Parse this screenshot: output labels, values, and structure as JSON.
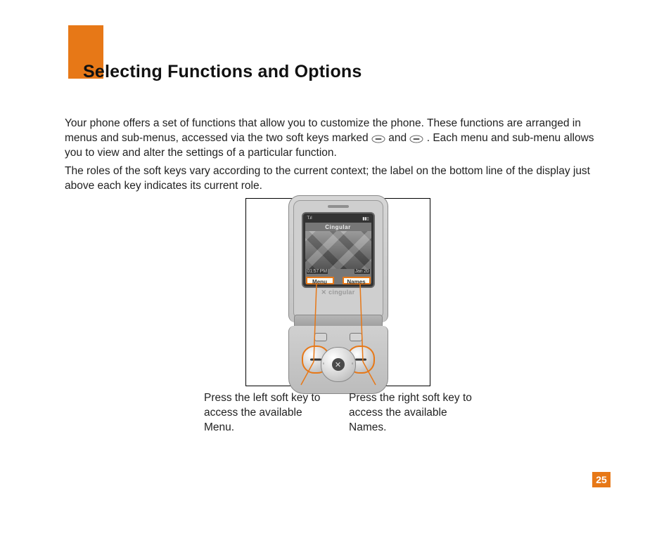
{
  "colors": {
    "accent": "#e77817"
  },
  "header": {
    "title": "Selecting Functions and Options"
  },
  "body": {
    "para1_a": "Your phone offers a set of functions that allow you to customize the phone. These functions are arranged in menus and sub-menus, accessed via the two soft keys marked ",
    "para1_b": " and ",
    "para1_c": " . Each menu and sub-menu allows you to view and alter the settings of a particular function.",
    "para2": "The roles of the soft keys vary according to the current context; the label on the bottom line of the display just above each key indicates its current role."
  },
  "figure": {
    "status_left": "T.ıl",
    "status_right": "▮▮▯",
    "carrier": "Cingular",
    "time_label": "01:57 PM",
    "date_label": "Jan 20",
    "softkey_left_label": "Menu",
    "softkey_right_label": "Names",
    "brand_label": "✕ cingular",
    "dpad_center_glyph": "✕"
  },
  "captions": {
    "left": "Press the left soft key to access the available Menu.",
    "right": "Press the right soft key to access the available Names."
  },
  "page": {
    "number": "25"
  }
}
